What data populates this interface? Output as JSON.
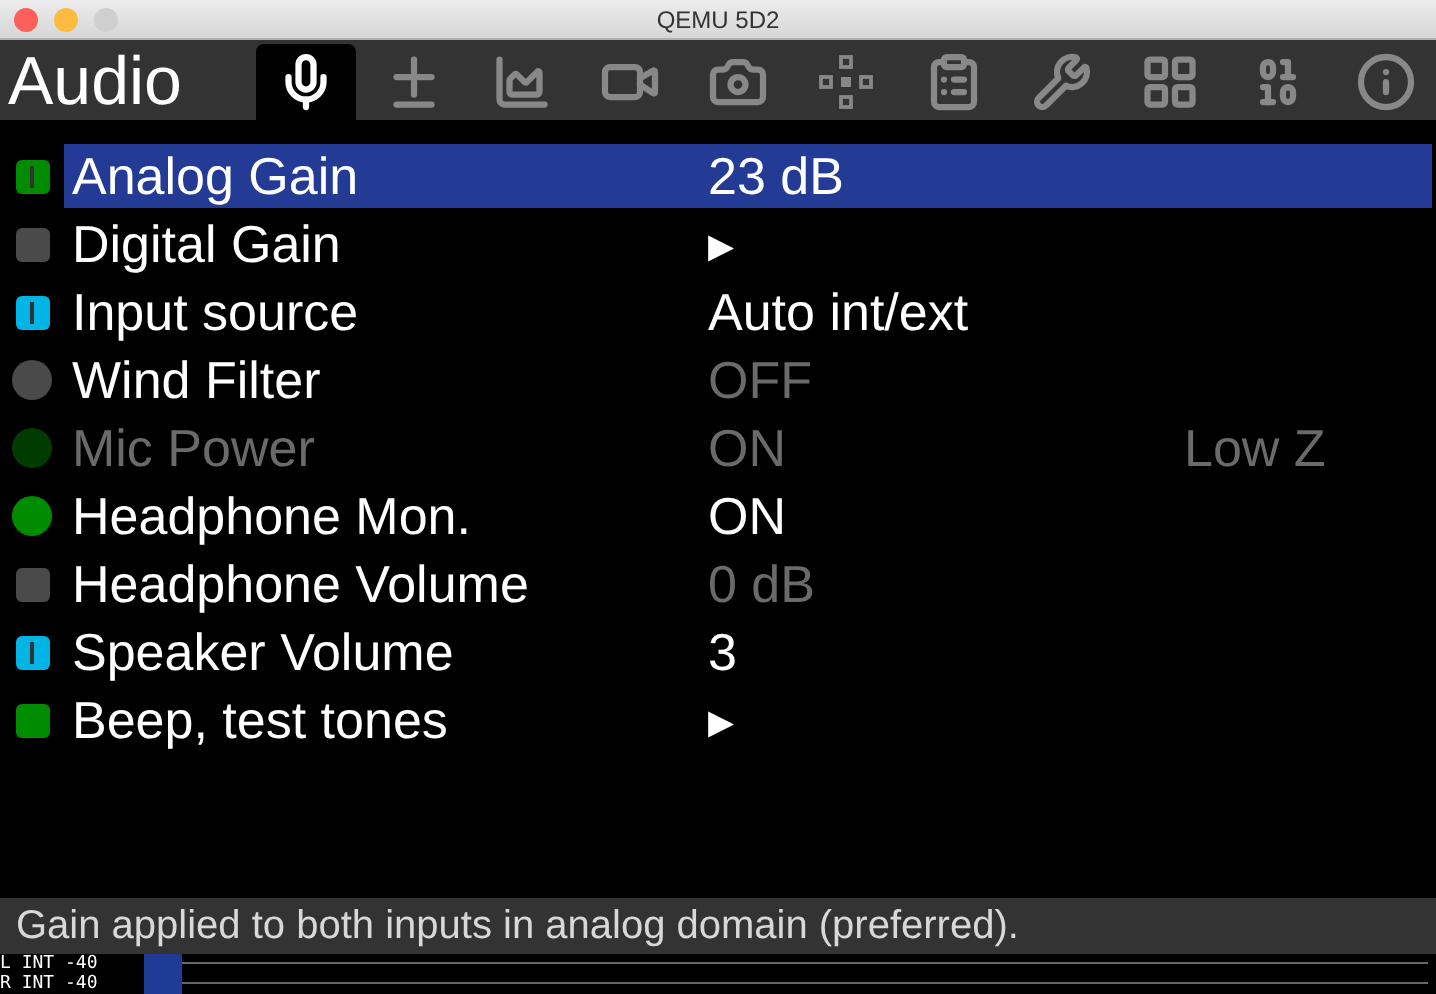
{
  "window": {
    "title": "QEMU 5D2"
  },
  "header": {
    "title": "Audio"
  },
  "tabs": [
    {
      "kind": "mic",
      "selected": true
    },
    {
      "kind": "expo",
      "selected": false
    },
    {
      "kind": "histogram",
      "selected": false
    },
    {
      "kind": "movie",
      "selected": false
    },
    {
      "kind": "camera",
      "selected": false
    },
    {
      "kind": "focus",
      "selected": false
    },
    {
      "kind": "display",
      "selected": false
    },
    {
      "kind": "prefs",
      "selected": false
    },
    {
      "kind": "modules",
      "selected": false
    },
    {
      "kind": "debug",
      "selected": false
    },
    {
      "kind": "info",
      "selected": false
    }
  ],
  "menu": [
    {
      "label": "Analog Gain",
      "value": "23 dB",
      "selected": true,
      "disabled": false,
      "value_dim": false,
      "indicator": {
        "kind": "square-bar",
        "color": "#008c00"
      }
    },
    {
      "label": "Digital Gain",
      "value": "▸",
      "selected": false,
      "disabled": false,
      "value_dim": false,
      "indicator": {
        "kind": "square",
        "color": "#4a4a4a"
      }
    },
    {
      "label": "Input source",
      "value": "Auto int/ext",
      "selected": false,
      "disabled": false,
      "value_dim": false,
      "indicator": {
        "kind": "square-bar",
        "color": "#00b4e6"
      }
    },
    {
      "label": "Wind Filter",
      "value": "OFF",
      "selected": false,
      "disabled": false,
      "value_dim": true,
      "indicator": {
        "kind": "circle",
        "color": "#4a4a4a"
      }
    },
    {
      "label": "Mic Power",
      "value": "ON",
      "extra": "Low Z",
      "selected": false,
      "disabled": true,
      "value_dim": true,
      "indicator": {
        "kind": "circle",
        "color": "#003c00"
      }
    },
    {
      "label": "Headphone Mon.",
      "value": "ON",
      "selected": false,
      "disabled": false,
      "value_dim": false,
      "indicator": {
        "kind": "circle",
        "color": "#008c00"
      }
    },
    {
      "label": "Headphone Volume",
      "value": "0 dB",
      "selected": false,
      "disabled": false,
      "value_dim": true,
      "indicator": {
        "kind": "square",
        "color": "#4a4a4a"
      }
    },
    {
      "label": "Speaker Volume",
      "value": "3",
      "selected": false,
      "disabled": false,
      "value_dim": false,
      "indicator": {
        "kind": "square-bar",
        "color": "#00b4e6"
      }
    },
    {
      "label": "Beep, test tones",
      "value": "▸",
      "selected": false,
      "disabled": false,
      "value_dim": false,
      "indicator": {
        "kind": "square",
        "color": "#008c00"
      }
    }
  ],
  "help": "Gain applied to both inputs in analog domain (preferred).",
  "meters": [
    {
      "label": "L INT -40",
      "level": 0.03
    },
    {
      "label": "R INT -40",
      "level": 0.03
    }
  ]
}
